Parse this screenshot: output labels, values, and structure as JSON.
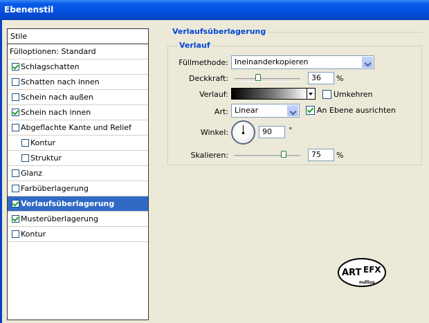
{
  "window": {
    "title": "Ebenenstil"
  },
  "stylelist": {
    "header": "Stile",
    "items": [
      {
        "label": "Fülloptionen: Standard",
        "checkbox": false,
        "checked": false,
        "indent": 0,
        "selected": false
      },
      {
        "label": "Schlagschatten",
        "checkbox": true,
        "checked": true,
        "indent": 0,
        "selected": false
      },
      {
        "label": "Schatten nach innen",
        "checkbox": true,
        "checked": false,
        "indent": 0,
        "selected": false
      },
      {
        "label": "Schein nach außen",
        "checkbox": true,
        "checked": false,
        "indent": 0,
        "selected": false
      },
      {
        "label": "Schein nach innen",
        "checkbox": true,
        "checked": true,
        "indent": 0,
        "selected": false
      },
      {
        "label": "Abgeflachte Kante und Relief",
        "checkbox": true,
        "checked": false,
        "indent": 0,
        "selected": false
      },
      {
        "label": "Kontur",
        "checkbox": true,
        "checked": false,
        "indent": 1,
        "selected": false
      },
      {
        "label": "Struktur",
        "checkbox": true,
        "checked": false,
        "indent": 1,
        "selected": false
      },
      {
        "label": "Glanz",
        "checkbox": true,
        "checked": false,
        "indent": 0,
        "selected": false
      },
      {
        "label": "Farbüberlagerung",
        "checkbox": true,
        "checked": false,
        "indent": 0,
        "selected": false
      },
      {
        "label": "Verlaufsüberlagerung",
        "checkbox": true,
        "checked": true,
        "indent": 0,
        "selected": true
      },
      {
        "label": "Musterüberlagerung",
        "checkbox": true,
        "checked": true,
        "indent": 0,
        "selected": false
      },
      {
        "label": "Kontur",
        "checkbox": true,
        "checked": false,
        "indent": 0,
        "selected": false
      }
    ]
  },
  "panel": {
    "section_title": "Verlaufsüberlagerung",
    "group_title": "Verlauf",
    "blend_mode": {
      "label": "Füllmethode:",
      "value": "Ineinanderkopieren"
    },
    "opacity": {
      "label": "Deckkraft:",
      "value": "36",
      "unit": "%",
      "percent": 36
    },
    "gradient": {
      "label": "Verlauf:",
      "reverse_label": "Umkehren",
      "reverse_checked": false
    },
    "style": {
      "label": "Art:",
      "value": "Linear",
      "align_label": "An Ebene ausrichten",
      "align_checked": true
    },
    "angle": {
      "label": "Winkel:",
      "value": "90",
      "unit": "°"
    },
    "scale": {
      "label": "Skalieren:",
      "value": "75",
      "unit": "%",
      "percent": 75
    }
  },
  "logo": {
    "line1": "ART",
    "line2": "EFX",
    "line3": "nullius"
  },
  "colors": {
    "titlebar": "#0553e2",
    "selection": "#316ac5",
    "accent_text": "#0046d5",
    "dialog_bg": "#ece9d8"
  }
}
